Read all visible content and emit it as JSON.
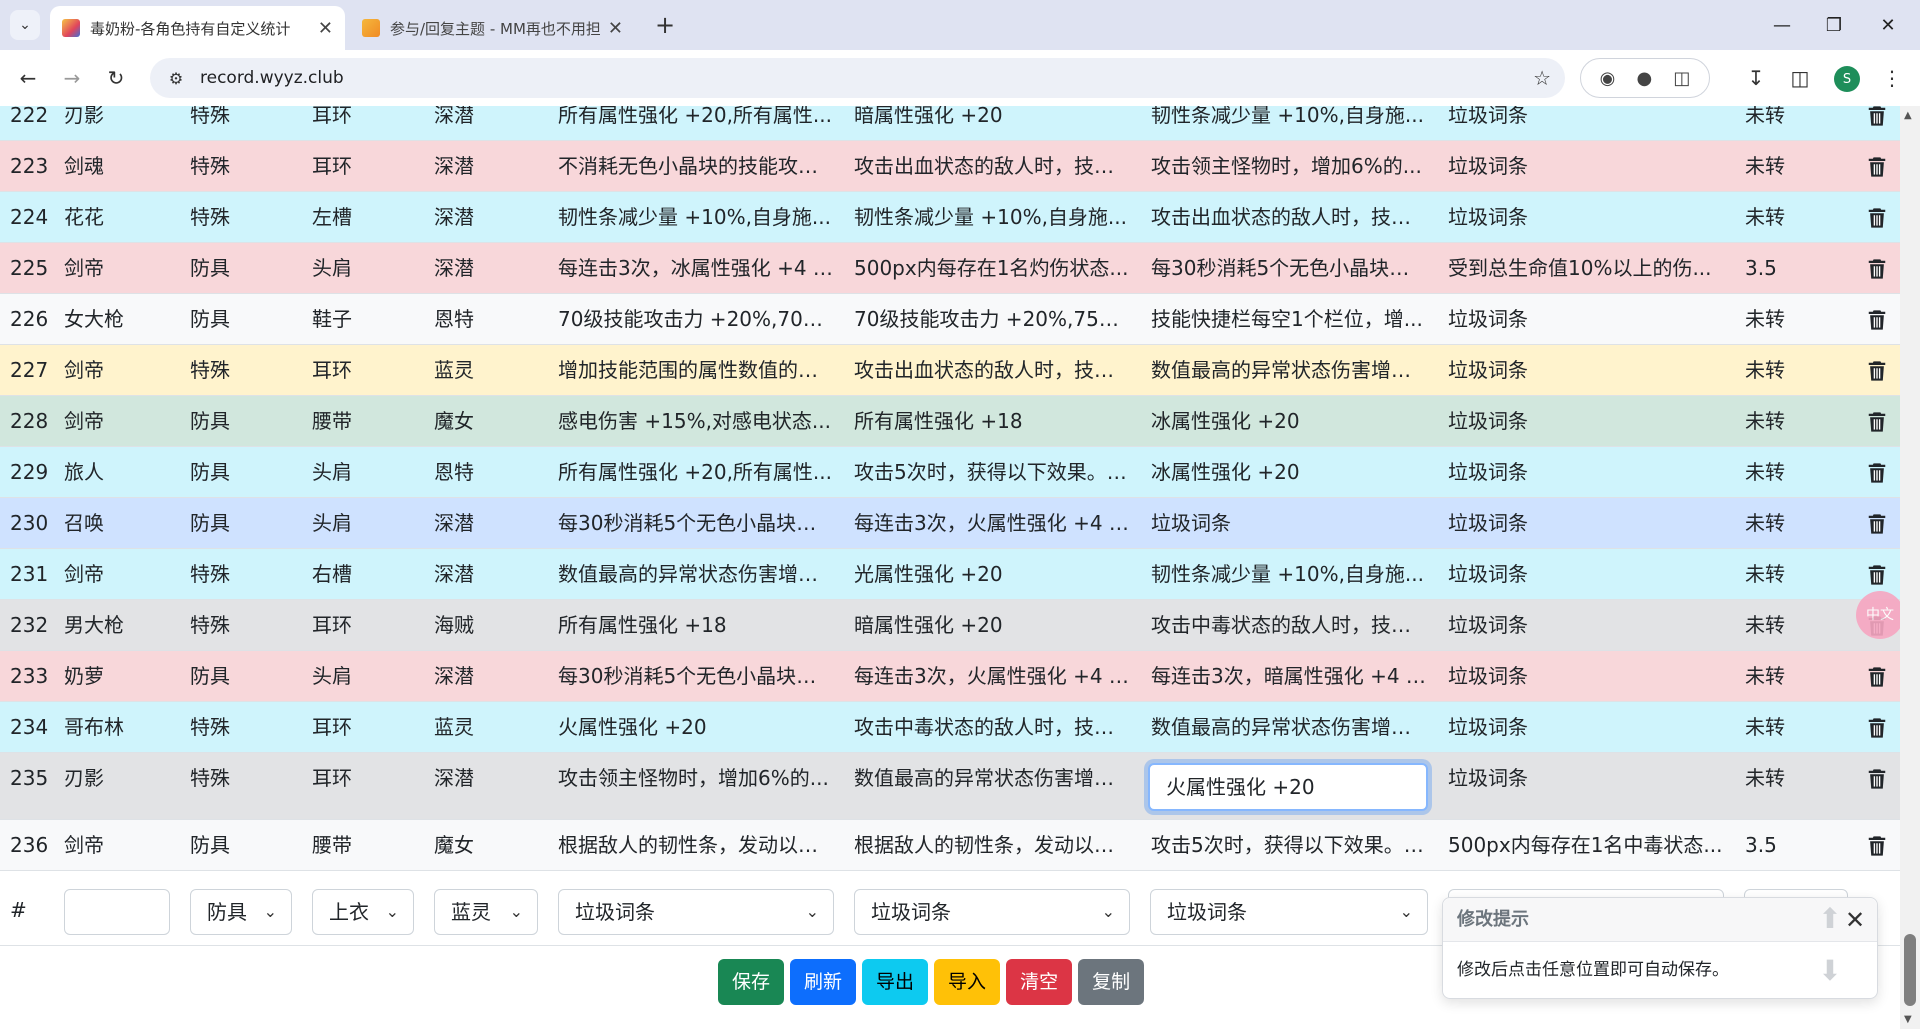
{
  "browser": {
    "tabs": [
      {
        "title": "毒奶粉-各角色持有自定义统计",
        "active": true
      },
      {
        "title": "参与/回复主题 - MM再也不用担心我",
        "active": false
      }
    ],
    "url": "record.wyyz.club",
    "profile_initial": "S"
  },
  "table": {
    "rows": [
      {
        "id": "222",
        "role": "刃影",
        "type": "特殊",
        "slot": "耳环",
        "set": "深潜",
        "c1": "所有属性强化 +20,所有属性...",
        "c2": "暗属性强化 +20",
        "c3": "韧性条减少量 +10%,自身施...",
        "c4": "垃圾词条",
        "status": "未转",
        "bg": "info"
      },
      {
        "id": "223",
        "role": "剑魂",
        "type": "特殊",
        "slot": "耳环",
        "set": "深潜",
        "c1": "不消耗无色小晶块的技能攻击...",
        "c2": "攻击出血状态的敌人时，技能...",
        "c3": "攻击领主怪物时，增加6%的...",
        "c4": "垃圾词条",
        "status": "未转",
        "bg": "danger"
      },
      {
        "id": "224",
        "role": "花花",
        "type": "特殊",
        "slot": "左槽",
        "set": "深潜",
        "c1": "韧性条减少量 +10%,自身施...",
        "c2": "韧性条减少量 +10%,自身施...",
        "c3": "攻击出血状态的敌人时，技能...",
        "c4": "垃圾词条",
        "status": "未转",
        "bg": "info"
      },
      {
        "id": "225",
        "role": "剑帝",
        "type": "防具",
        "slot": "头肩",
        "set": "深潜",
        "c1": "每连击3次，冰属性强化 +4 (...",
        "c2": "500px内每存在1名灼伤状态...",
        "c3": "每30秒消耗5个无色小晶块获...",
        "c4": "受到总生命值10%以上的伤...",
        "status": "3.5",
        "bg": "danger"
      },
      {
        "id": "226",
        "role": "女大枪",
        "type": "防具",
        "slot": "鞋子",
        "set": "恩特",
        "c1": "70级技能攻击力 +20%,70级...",
        "c2": "70级技能攻击力 +20%,75级...",
        "c3": "技能快捷栏每空1个栏位，增...",
        "c4": "垃圾词条",
        "status": "未转",
        "bg": "light"
      },
      {
        "id": "227",
        "role": "剑帝",
        "type": "特殊",
        "slot": "耳环",
        "set": "蓝灵",
        "c1": "增加技能范围的属性数值的总...",
        "c2": "攻击出血状态的敌人时，技能...",
        "c3": "数值最高的异常状态伤害增加...",
        "c4": "垃圾词条",
        "status": "未转",
        "bg": "warning"
      },
      {
        "id": "228",
        "role": "剑帝",
        "type": "防具",
        "slot": "腰带",
        "set": "魔女",
        "c1": "感电伤害 +15%,对感电状态...",
        "c2": "所有属性强化 +18",
        "c3": "冰属性强化 +20",
        "c4": "垃圾词条",
        "status": "未转",
        "bg": "success"
      },
      {
        "id": "229",
        "role": "旅人",
        "type": "防具",
        "slot": "头肩",
        "set": "恩特",
        "c1": "所有属性强化 +20,所有属性...",
        "c2": "攻击5次时，获得以下效果。 ...",
        "c3": "冰属性强化 +20",
        "c4": "垃圾词条",
        "status": "未转",
        "bg": "info"
      },
      {
        "id": "230",
        "role": "召唤",
        "type": "防具",
        "slot": "头肩",
        "set": "深潜",
        "c1": "每30秒消耗5个无色小晶块获...",
        "c2": "每连击3次，火属性强化 +4 (...",
        "c3": "垃圾词条",
        "c4": "垃圾词条",
        "status": "未转",
        "bg": "primary"
      },
      {
        "id": "231",
        "role": "剑帝",
        "type": "特殊",
        "slot": "右槽",
        "set": "深潜",
        "c1": "数值最高的异常状态伤害增加...",
        "c2": "光属性强化 +20",
        "c3": "韧性条减少量 +10%,自身施...",
        "c4": "垃圾词条",
        "status": "未转",
        "bg": "info"
      },
      {
        "id": "232",
        "role": "男大枪",
        "type": "特殊",
        "slot": "耳环",
        "set": "海贼",
        "c1": "所有属性强化 +18",
        "c2": "暗属性强化 +20",
        "c3": "攻击中毒状态的敌人时，技能...",
        "c4": "垃圾词条",
        "status": "未转",
        "bg": "secondary"
      },
      {
        "id": "233",
        "role": "奶萝",
        "type": "防具",
        "slot": "头肩",
        "set": "深潜",
        "c1": "每30秒消耗5个无色小晶块获...",
        "c2": "每连击3次，火属性强化 +4 (...",
        "c3": "每连击3次，暗属性强化 +4 (...",
        "c4": "垃圾词条",
        "status": "未转",
        "bg": "danger"
      },
      {
        "id": "234",
        "role": "哥布林",
        "type": "特殊",
        "slot": "耳环",
        "set": "蓝灵",
        "c1": "火属性强化 +20",
        "c2": "攻击中毒状态的敌人时，技能...",
        "c3": "数值最高的异常状态伤害增加...",
        "c4": "垃圾词条",
        "status": "未转",
        "bg": "info"
      },
      {
        "id": "235",
        "role": "刃影",
        "type": "特殊",
        "slot": "耳环",
        "set": "深潜",
        "c1": "攻击领主怪物时，增加6%的...",
        "c2": "数值最高的异常状态伤害增加...",
        "c3": "",
        "c4": "垃圾词条",
        "status": "未转",
        "bg": "secondary",
        "editing_value": "火属性强化 +20"
      },
      {
        "id": "236",
        "role": "剑帝",
        "type": "防具",
        "slot": "腰带",
        "set": "魔女",
        "c1": "根据敌人的韧性条，发动以下...",
        "c2": "根据敌人的韧性条，发动以下...",
        "c3": "攻击5次时，获得以下效果。 ...",
        "c4": "500px内每存在1名中毒状态...",
        "status": "3.5",
        "bg": "light"
      }
    ]
  },
  "add_row": {
    "hash": "#",
    "name_value": "",
    "type_select": "防具",
    "slot_select": "上衣",
    "set_select": "蓝灵",
    "c1_select": "垃圾词条",
    "c2_select": "垃圾词条",
    "c3_select": "垃圾词条"
  },
  "buttons": {
    "save": "保存",
    "refresh": "刷新",
    "export": "导出",
    "import": "导入",
    "clear": "清空",
    "copy": "复制"
  },
  "toast": {
    "title": "修改提示",
    "body": "修改后点击任意位置即可自动保存。"
  },
  "ime_badge": "中文",
  "colors": {
    "info": "#cff4fc",
    "danger": "#f8d7da",
    "light": "#f8f9fa",
    "warning": "#fff3cd",
    "success": "#d1e7dd",
    "primary": "#cfe2ff",
    "secondary": "#e2e3e5",
    "btn_save": "#198754",
    "btn_refresh": "#0d6efd",
    "btn_export": "#0dcaf0",
    "btn_import": "#ffc107",
    "btn_clear": "#dc3545",
    "btn_copy": "#6c757d"
  }
}
